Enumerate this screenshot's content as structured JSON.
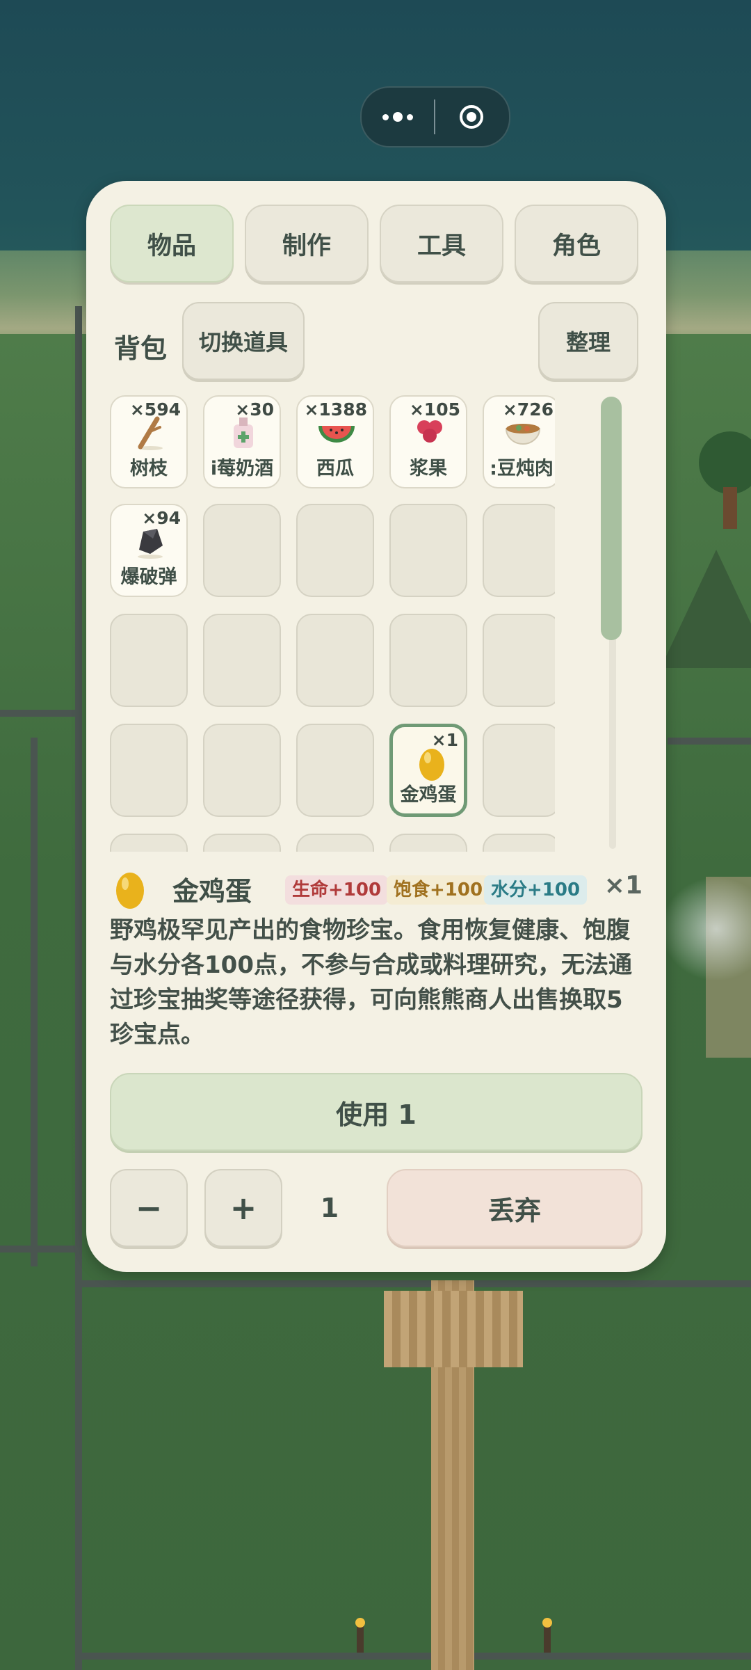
{
  "tabs": [
    {
      "label": "物品",
      "active": true
    },
    {
      "label": "制作",
      "active": false
    },
    {
      "label": "工具",
      "active": false
    },
    {
      "label": "角色",
      "active": false
    }
  ],
  "bag": {
    "title": "背包",
    "switch_label": "切换道具",
    "sort_label": "整理"
  },
  "items": [
    {
      "name": "树枝",
      "count": "×594",
      "icon": "branch-icon"
    },
    {
      "name": "i莓奶酒",
      "count": "×30",
      "icon": "berry-wine-icon"
    },
    {
      "name": "西瓜",
      "count": "×1388",
      "icon": "watermelon-icon"
    },
    {
      "name": "浆果",
      "count": "×105",
      "icon": "berry-icon"
    },
    {
      "name": ":豆炖肉",
      "count": "×726",
      "icon": "stew-bowl-icon"
    },
    {
      "name": "爆破弹",
      "count": "×94",
      "icon": "bomb-icon"
    },
    {
      "name": "金鸡蛋",
      "count": "×1",
      "icon": "golden-egg-icon",
      "selected": true
    }
  ],
  "detail": {
    "name": "金鸡蛋",
    "icon": "golden-egg-icon",
    "badges": [
      "生命+100",
      "饱食+100",
      "水分+100"
    ],
    "quantity": "×1",
    "description": "野鸡极罕见产出的食物珍宝。食用恢复健康、饱腹与水分各100点，不参与合成或料理研究，无法通过珍宝抽奖等途径获得，可向熊熊商人出售换取5珍宝点。"
  },
  "actions": {
    "use_label": "使用 1",
    "minus_label": "−",
    "plus_label": "+",
    "amount": "1",
    "drop_label": "丢弃"
  },
  "colors": {
    "panel": "#f4f1e4",
    "active_tab": "#dde7cf",
    "use_button": "#dbe6cd",
    "drop_button": "#f2e2d8",
    "selected_border": "#6f9a75",
    "scroll_thumb": "#a8c0a0"
  }
}
